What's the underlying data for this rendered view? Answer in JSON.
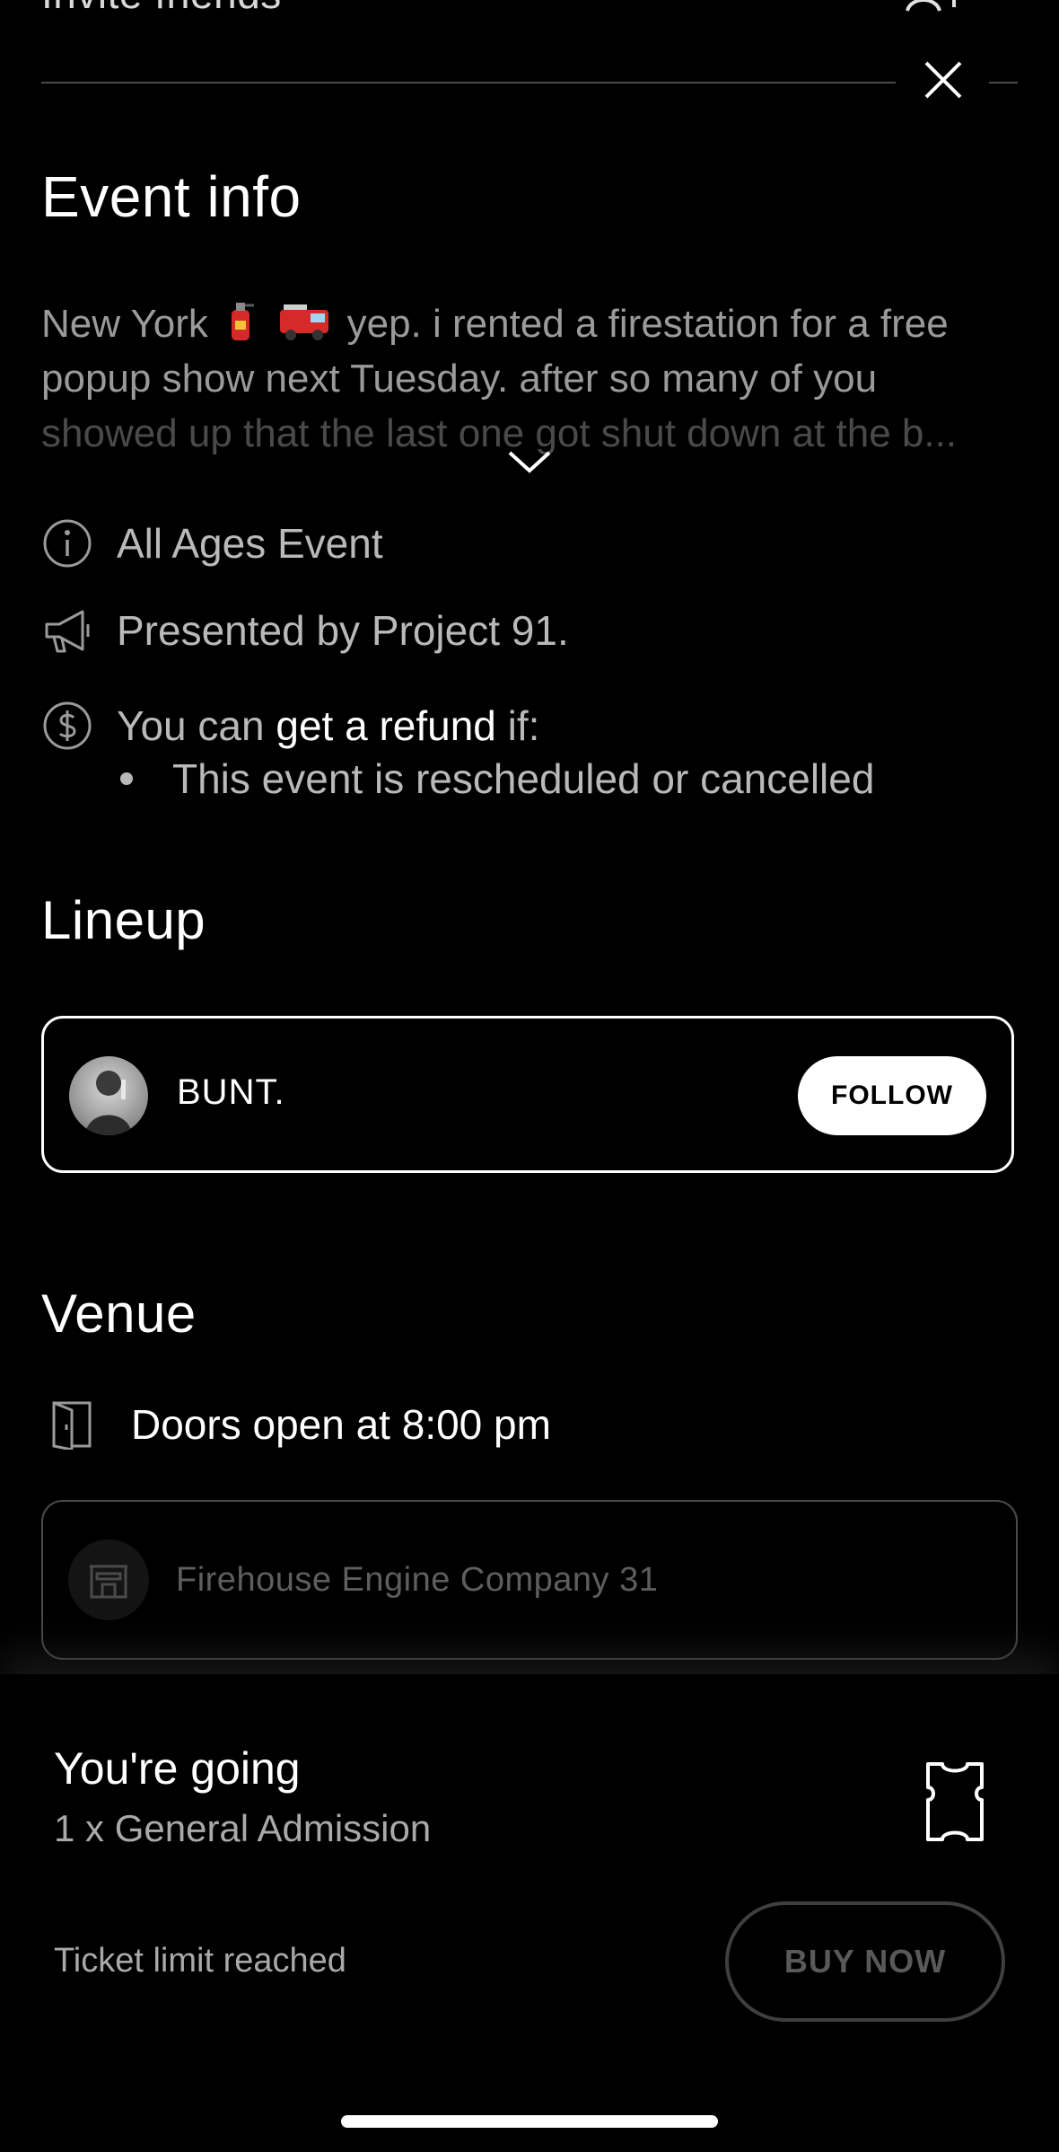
{
  "header": {
    "partial_title": "Invite friends",
    "add_friend_icon": "person-add-icon",
    "close_icon": "close-icon"
  },
  "event_info": {
    "title": "Event info",
    "description_lines": [
      "New York",
      "yep. i rented a firestation for a free",
      "popup show next Tuesday. after so many of you",
      "showed up that the last one got shut down at the b..."
    ],
    "emojis": [
      "fire-extinguisher-emoji",
      "fire-engine-emoji"
    ],
    "expand_icon": "chevron-down-icon",
    "age_label": "All Ages Event",
    "presented_by": "Presented by Project 91.",
    "refund": {
      "prefix": "You can",
      "emphasis": "get a refund",
      "suffix": "if:",
      "conditions": [
        "This event is rescheduled or cancelled"
      ]
    }
  },
  "lineup": {
    "title": "Lineup",
    "artists": [
      {
        "name": "BUNT.",
        "follow_label": "FOLLOW"
      }
    ]
  },
  "venue": {
    "title": "Venue",
    "doors": "Doors open at 8:00 pm",
    "name": "Firehouse Engine Company 31"
  },
  "ticket": {
    "status": "You're going",
    "detail": "1 x General Admission",
    "limit_text": "Ticket limit reached",
    "buy_label": "BUY NOW"
  },
  "colors": {
    "background": "#000000",
    "muted_text": "#9a9a9a",
    "disabled_text": "#595959",
    "border_muted": "#4a4a4a"
  }
}
